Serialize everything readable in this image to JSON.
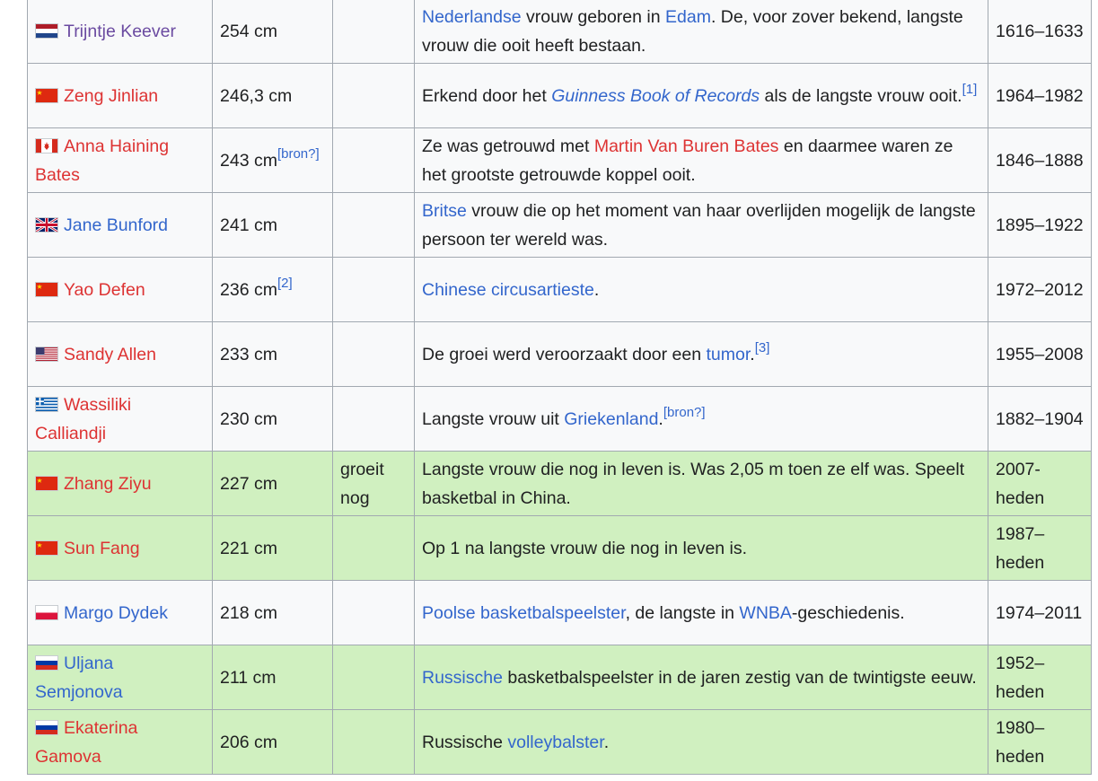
{
  "rows": [
    {
      "name": "Trijntje Keever",
      "flag": "flag-netherlands-icon",
      "length": "254 cm",
      "note": "",
      "desc_a": "Nederlandse",
      "desc_b": " vrouw geboren in ",
      "desc_c": "Edam",
      "desc_d": ". De, voor zover bekend, langste vrouw die ooit heeft bestaan.",
      "years": "1616–1633"
    },
    {
      "name": "Zeng Jinlian",
      "flag": "flag-china-icon",
      "length": "246,3 cm",
      "note": "",
      "desc_a": "Erkend door het ",
      "desc_b": "Guinness Book of Records",
      "desc_c": " als de langste vrouw ooit.",
      "ref": "[1]",
      "years": "1964–1982"
    },
    {
      "name": "Anna Haining Bates",
      "flag": "flag-canada-icon",
      "length": "243 cm",
      "length_ref": "[bron?]",
      "note": "",
      "desc_a": "Ze was getrouwd met ",
      "desc_b": "Martin Van Buren Bates",
      "desc_c": " en daarmee waren ze het grootste getrouwde koppel ooit.",
      "years": "1846–1888"
    },
    {
      "name": "Jane Bunford",
      "flag": "flag-uk-icon",
      "length": "241 cm",
      "note": "",
      "desc_a": "Britse",
      "desc_b": " vrouw die op het moment van haar overlijden mogelijk de langste persoon ter wereld was.",
      "years": "1895–1922"
    },
    {
      "name": "Yao Defen",
      "flag": "flag-china-icon",
      "length": "236 cm",
      "length_ref": "[2]",
      "note": "",
      "desc_a": "Chinese circusartieste",
      "desc_b": ".",
      "years": "1972–2012"
    },
    {
      "name": "Sandy Allen",
      "flag": "flag-usa-icon",
      "length": "233 cm",
      "note": "",
      "desc_a": "De groei werd veroorzaakt door een ",
      "desc_b": "tumor",
      "desc_c": ".",
      "ref": "[3]",
      "years": "1955–2008"
    },
    {
      "name": "Wassiliki Calliandji",
      "flag": "flag-greece-icon",
      "length": "230 cm",
      "note": "",
      "desc_a": "Langste vrouw uit ",
      "desc_b": "Griekenland",
      "desc_c": ".",
      "ref": "[bron?]",
      "years": "1882–1904"
    },
    {
      "name": "Zhang Ziyu",
      "flag": "flag-china-icon",
      "length": "227 cm",
      "note": "groeit nog",
      "desc_a": "Langste vrouw die nog in leven is. Was 2,05 m toen ze elf was. Speelt basketbal in China.",
      "years": "2007-heden"
    },
    {
      "name": "Sun Fang",
      "flag": "flag-china-icon",
      "length": "221 cm",
      "note": "",
      "desc_a": "Op 1 na langste vrouw die nog in leven is.",
      "years": "1987–heden"
    },
    {
      "name": "Margo Dydek",
      "flag": "flag-poland-icon",
      "length": "218 cm",
      "note": "",
      "desc_a": "Poolse basketbalspeelster",
      "desc_b": ", de langste in ",
      "desc_c": "WNBA",
      "desc_d": "-geschiedenis.",
      "years": "1974–2011"
    },
    {
      "name": "Uljana Semjonova",
      "flag": "flag-russia-icon",
      "length": "211 cm",
      "note": "",
      "desc_a": "Russische",
      "desc_b": " basketbalspeelster in de jaren zestig van de twintigste eeuw.",
      "years": "1952–heden"
    },
    {
      "name": "Ekaterina Gamova",
      "flag": "flag-russia-icon",
      "length": "206 cm",
      "note": "",
      "desc_a": "Russische ",
      "desc_b": "volleybalster",
      "desc_c": ".",
      "years": "1980–heden"
    }
  ],
  "colors": {
    "link": "#3366cc",
    "redlink": "#dd3333",
    "visited": "#6b4ba1",
    "alive_row": "#d0f0c0",
    "row_bg": "#f8f9fa",
    "border": "#a2a9b1"
  }
}
